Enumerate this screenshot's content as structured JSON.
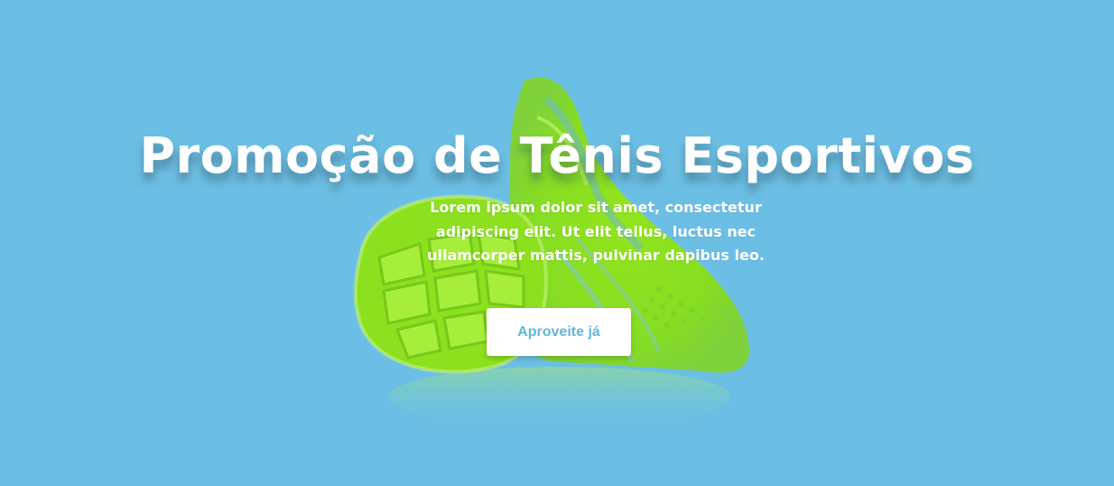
{
  "hero": {
    "headline": "Promoção de Tênis Esportivos",
    "subtitle": "Lorem ipsum dolor sit amet, consectetur adipiscing elit. Ut elit tellus, luctus nec ullamcorper mattis, pulvinar dapibus leo.",
    "cta_label": "Aproveite já",
    "image": "green-running-shoes"
  },
  "colors": {
    "background": "#6cbfe4",
    "shoe": "#8fe21a",
    "cta_text": "#61b7db",
    "text": "#ffffff"
  }
}
